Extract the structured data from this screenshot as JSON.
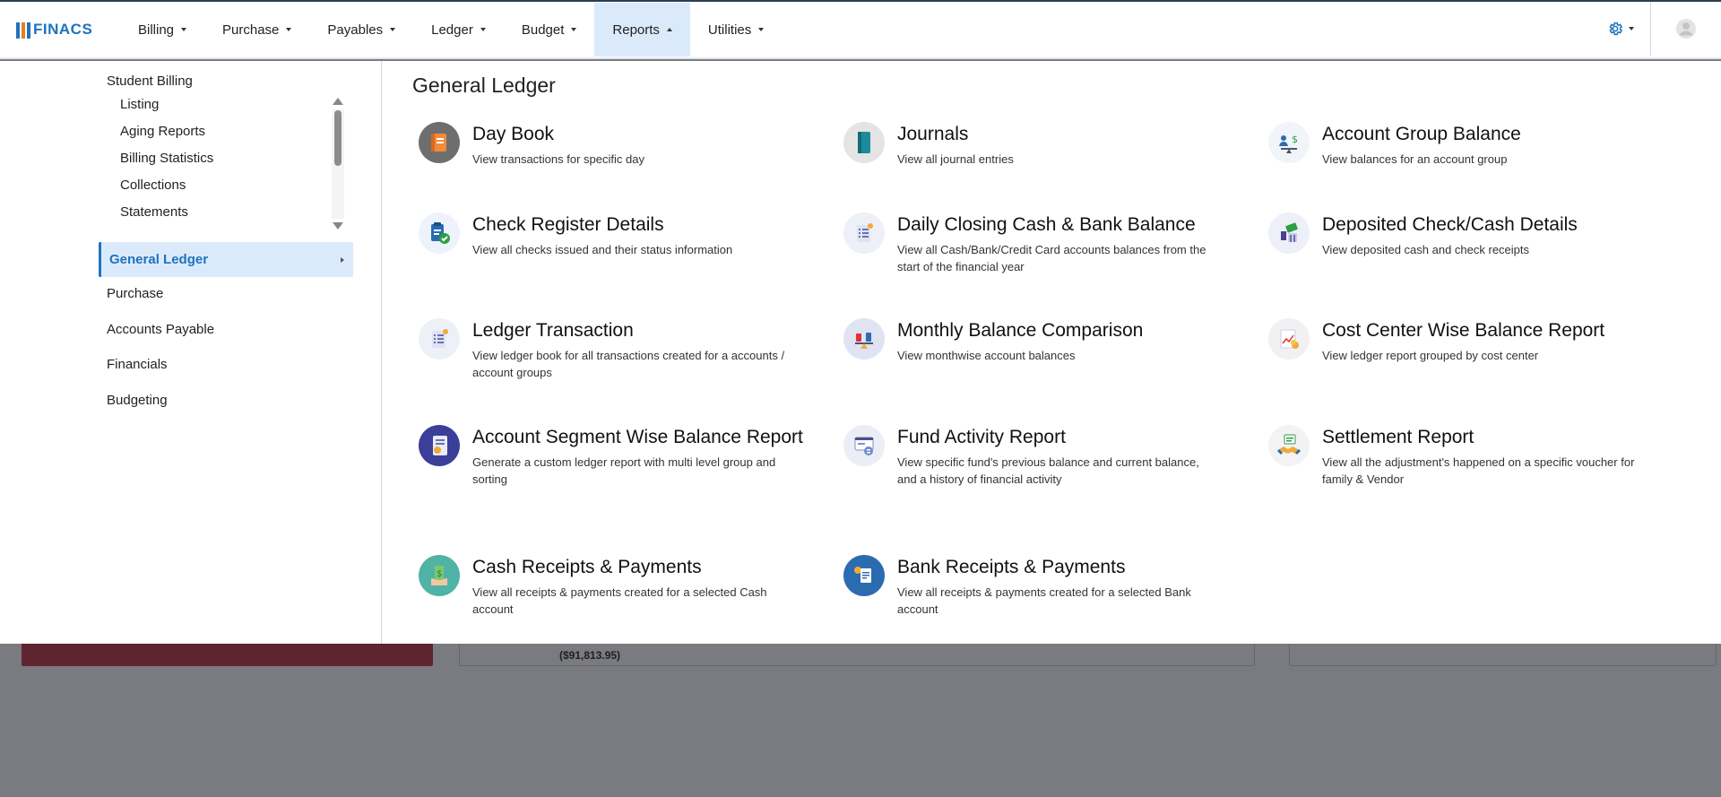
{
  "app": {
    "logo_text": "FINACS",
    "logo_mark_colors": [
      "#1e73be",
      "#e67e22",
      "#1e73be"
    ]
  },
  "nav": {
    "items": [
      {
        "label": "Billing"
      },
      {
        "label": "Purchase"
      },
      {
        "label": "Payables"
      },
      {
        "label": "Ledger"
      },
      {
        "label": "Budget"
      },
      {
        "label": "Reports",
        "active": true
      },
      {
        "label": "Utilities"
      }
    ],
    "settings_icon": "gear-icon",
    "profile_icon": "user-avatar-icon"
  },
  "background": {
    "amount_text": "($91,813.95)"
  },
  "sidebar": {
    "student_billing": {
      "title": "Student Billing",
      "items": [
        "Listing",
        "Aging Reports",
        "Billing Statistics",
        "Collections",
        "Statements"
      ]
    },
    "active_item": "General Ledger",
    "items": [
      "Purchase",
      "Accounts Payable",
      "Financials",
      "Budgeting"
    ]
  },
  "content": {
    "title": "General Ledger",
    "reports": [
      {
        "title": "Day Book",
        "desc": "View transactions for specific day",
        "icon": "day-book-icon"
      },
      {
        "title": "Journals",
        "desc": "View all journal entries",
        "icon": "journals-icon"
      },
      {
        "title": "Account Group Balance",
        "desc": "View balances for an account group",
        "icon": "account-group-balance-icon"
      },
      {
        "title": "Check Register Details",
        "desc": "View all checks issued and their status information",
        "icon": "check-register-icon"
      },
      {
        "title": "Daily Closing Cash & Bank Balance",
        "desc": "View all Cash/Bank/Credit Card accounts balances from the start of the financial year",
        "icon": "daily-closing-icon"
      },
      {
        "title": "Deposited Check/Cash Details",
        "desc": "View deposited cash and check receipts",
        "icon": "deposited-check-icon"
      },
      {
        "title": "Ledger Transaction",
        "desc": "View ledger book for all transactions created for a accounts / account groups",
        "icon": "ledger-transaction-icon"
      },
      {
        "title": "Monthly Balance Comparison",
        "desc": "View monthwise account balances",
        "icon": "monthly-balance-icon"
      },
      {
        "title": "Cost Center Wise Balance Report",
        "desc": "View ledger report grouped by cost center",
        "icon": "cost-center-icon"
      },
      {
        "title": "Account Segment Wise Balance Report",
        "desc": "Generate a custom ledger report with multi level group and sorting",
        "icon": "account-segment-icon"
      },
      {
        "title": "Fund Activity Report",
        "desc": "View specific fund's previous balance and current balance, and a history of financial activity",
        "icon": "fund-activity-icon"
      },
      {
        "title": "Settlement Report",
        "desc": "View all the adjustment's happened on a specific voucher for family & Vendor",
        "icon": "settlement-icon"
      },
      {
        "title": "Cash Receipts & Payments",
        "desc": "View all receipts & payments created for a selected Cash account",
        "icon": "cash-receipts-icon"
      },
      {
        "title": "Bank Receipts & Payments",
        "desc": "View all receipts & payments created for a selected Bank account",
        "icon": "bank-receipts-icon"
      }
    ]
  }
}
